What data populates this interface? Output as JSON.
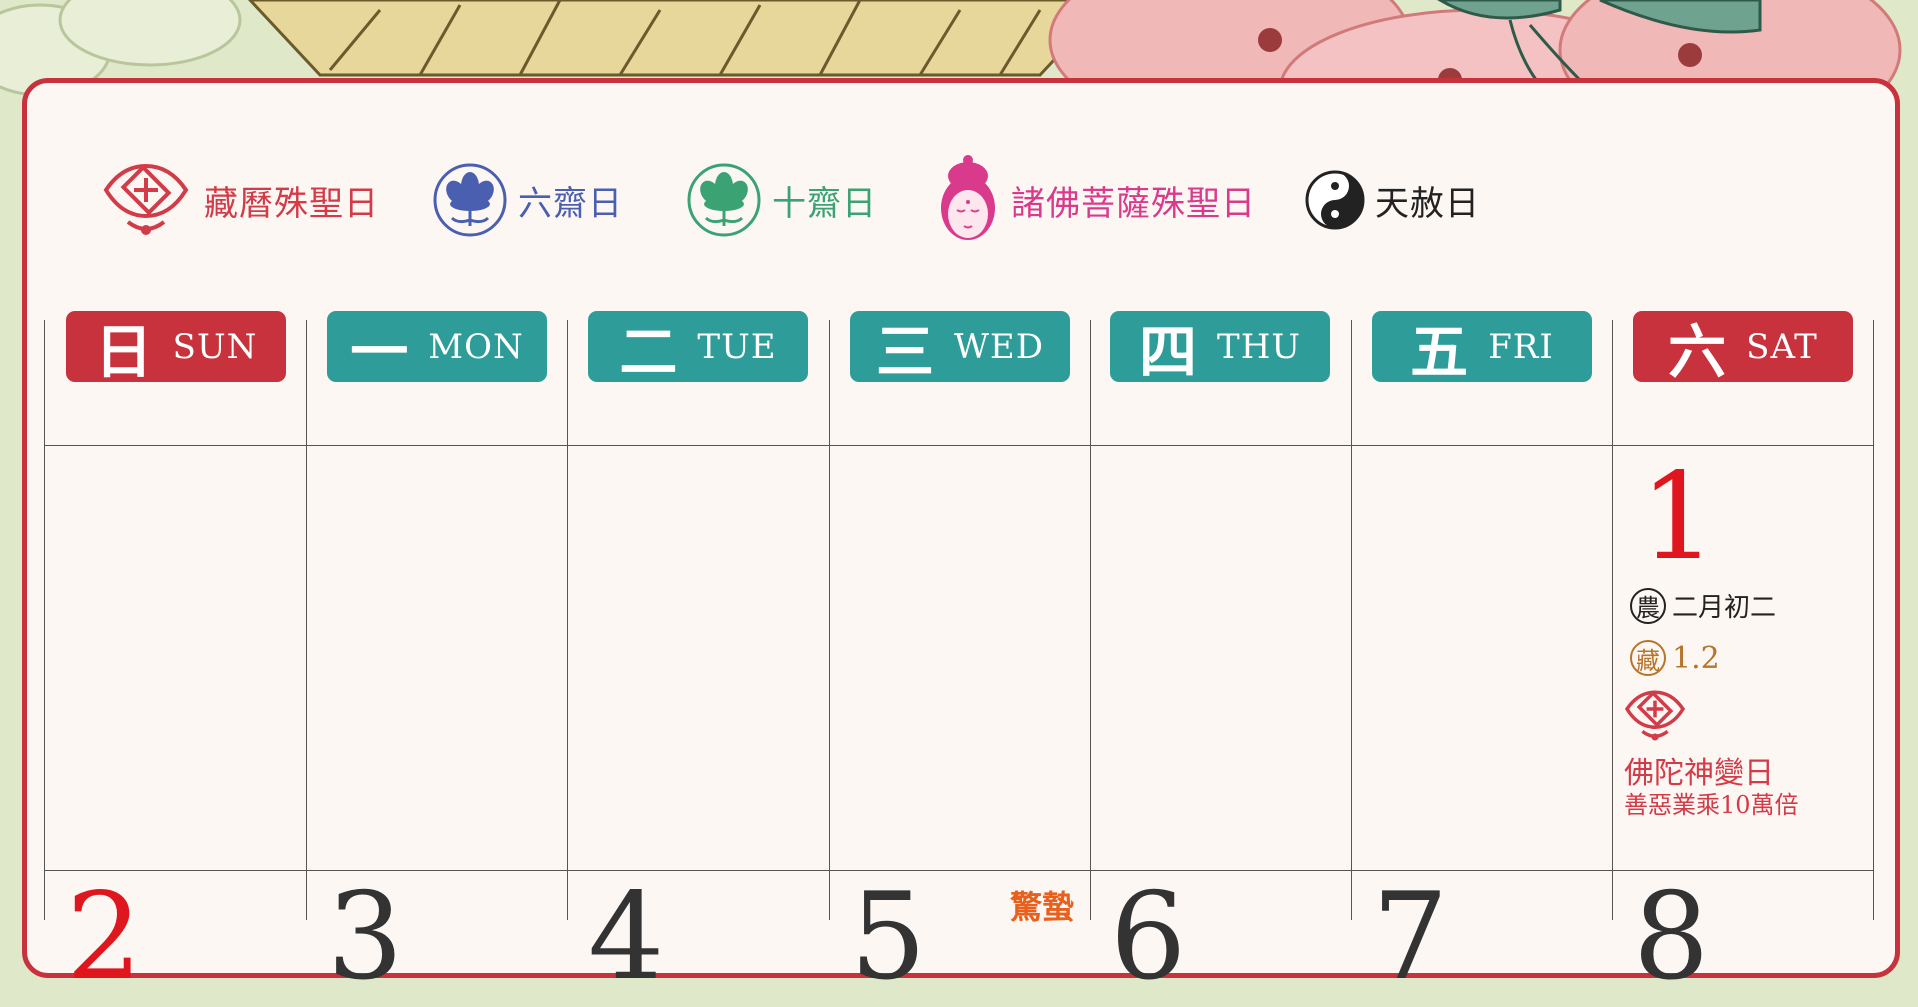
{
  "legend": [
    {
      "icon": "endless-knot-icon",
      "label": "藏曆殊聖日",
      "color": "#d23b48"
    },
    {
      "icon": "lotus-blue-icon",
      "label": "六齋日",
      "color": "#4a5fb0"
    },
    {
      "icon": "lotus-green-icon",
      "label": "十齋日",
      "color": "#3aa273"
    },
    {
      "icon": "buddha-head-icon",
      "label": "諸佛菩薩殊聖日",
      "color": "#d93a8c"
    },
    {
      "icon": "yin-yang-icon",
      "label": "天赦日",
      "color": "#222222"
    }
  ],
  "days": [
    {
      "zh": "日",
      "en": "SUN",
      "color": "#c8323c"
    },
    {
      "zh": "一",
      "en": "MON",
      "color": "#2e9d9a"
    },
    {
      "zh": "二",
      "en": "TUE",
      "color": "#2e9d9a"
    },
    {
      "zh": "三",
      "en": "WED",
      "color": "#2e9d9a"
    },
    {
      "zh": "四",
      "en": "THU",
      "color": "#2e9d9a"
    },
    {
      "zh": "五",
      "en": "FRI",
      "color": "#2e9d9a"
    },
    {
      "zh": "六",
      "en": "SAT",
      "color": "#c8323c"
    }
  ],
  "sat1": {
    "date": "1",
    "lunar_badge": "農",
    "lunar": "二月初二",
    "tibetan_badge": "藏",
    "tibetan": "1.2",
    "event": "佛陀神變日",
    "event_note": "善惡業乘10萬倍"
  },
  "row2": [
    {
      "date": "2",
      "color": "#e0161e"
    },
    {
      "date": "3",
      "color": "#333333"
    },
    {
      "date": "4",
      "color": "#333333"
    },
    {
      "date": "5",
      "color": "#333333",
      "term": "驚蟄"
    },
    {
      "date": "6",
      "color": "#333333"
    },
    {
      "date": "7",
      "color": "#333333"
    },
    {
      "date": "8",
      "color": "#333333"
    }
  ]
}
